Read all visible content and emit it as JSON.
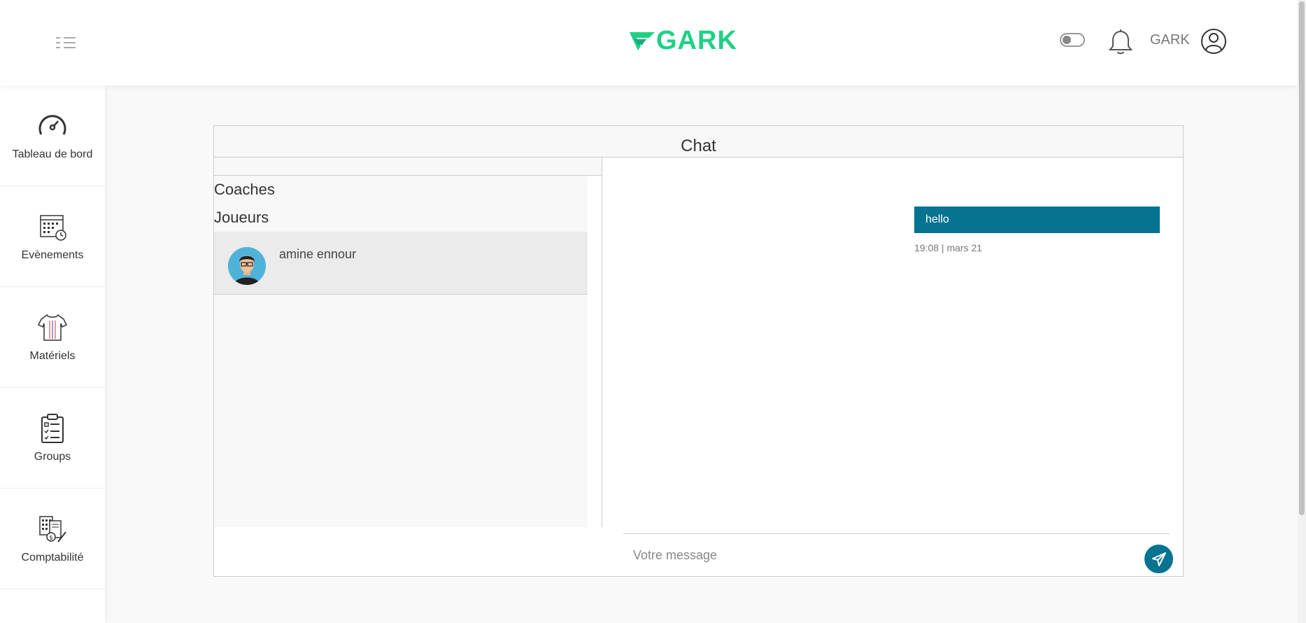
{
  "header": {
    "logo_text": "GARK",
    "username": "GARK"
  },
  "sidebar": {
    "items": [
      {
        "label": "Tableau de bord",
        "icon": "speedometer-icon"
      },
      {
        "label": "Evènements",
        "icon": "calendar-icon"
      },
      {
        "label": "Matériels",
        "icon": "jersey-icon"
      },
      {
        "label": "Groups",
        "icon": "clipboard-list-icon"
      },
      {
        "label": "Comptabilité",
        "icon": "accounting-icon"
      }
    ]
  },
  "chat": {
    "title": "Chat",
    "categories": [
      "Coaches",
      "Joueurs"
    ],
    "contacts": [
      {
        "name": "amine ennour"
      }
    ],
    "messages": [
      {
        "text": "hello",
        "time": "19:08 | mars 21"
      }
    ],
    "input_placeholder": "Votre message"
  },
  "colors": {
    "brand_green": "#1ed183",
    "accent_teal": "#067391"
  }
}
